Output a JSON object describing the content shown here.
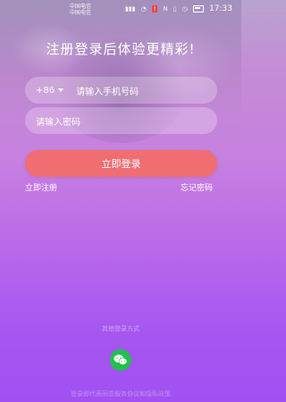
{
  "status_bar": {
    "carrier_line1": "中国电信 ",
    "carrier_line2": "中国电信 ",
    "time": "17:33"
  },
  "headline": "注册登录后体验更精彩!",
  "phone_field": {
    "country_code": "+86",
    "placeholder": "请输入手机号码"
  },
  "password_field": {
    "placeholder": "请输入密码"
  },
  "login_button": "立即登录",
  "links": {
    "register": "立即注册",
    "forgot_password": "忘记密码"
  },
  "other_login_label": "其他登录方式",
  "footer_text": "登录即代表同意服务协议和隐私政策",
  "colors": {
    "accent_button": "#f06d72",
    "wechat_green": "#1fc14c",
    "bg_top": "#b9a3cf",
    "bg_bottom": "#a150f2"
  }
}
